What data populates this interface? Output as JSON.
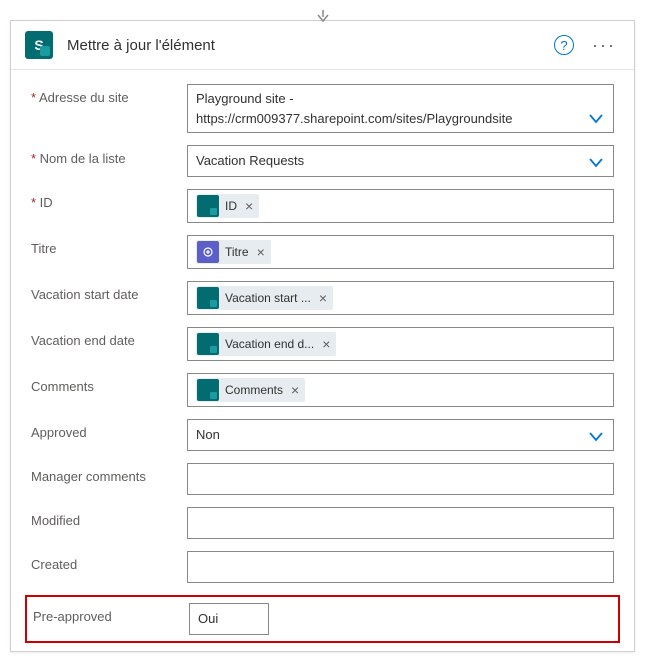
{
  "header": {
    "title": "Mettre à jour l'élément",
    "icon_letter": "S"
  },
  "fields": {
    "adresse_site": {
      "label": "Adresse du site",
      "line1": "Playground site -",
      "line2": "https://crm009377.sharepoint.com/sites/Playgroundsite"
    },
    "nom_liste": {
      "label": "Nom de la liste",
      "value": "Vacation Requests"
    },
    "id": {
      "label": "ID",
      "token": "ID"
    },
    "titre": {
      "label": "Titre",
      "token": "Titre"
    },
    "vac_start": {
      "label": "Vacation start date",
      "token": "Vacation start ..."
    },
    "vac_end": {
      "label": "Vacation end date",
      "token": "Vacation end d..."
    },
    "comments": {
      "label": "Comments",
      "token": "Comments"
    },
    "approved": {
      "label": "Approved",
      "value": "Non"
    },
    "manager_comments": {
      "label": "Manager comments",
      "value": ""
    },
    "modified": {
      "label": "Modified",
      "value": ""
    },
    "created": {
      "label": "Created",
      "value": ""
    },
    "pre_approved": {
      "label": "Pre-approved",
      "value": "Oui"
    }
  },
  "colors": {
    "accent_blue": "#0078d4",
    "sharepoint_teal": "#036C70",
    "highlight_red": "#c00"
  }
}
